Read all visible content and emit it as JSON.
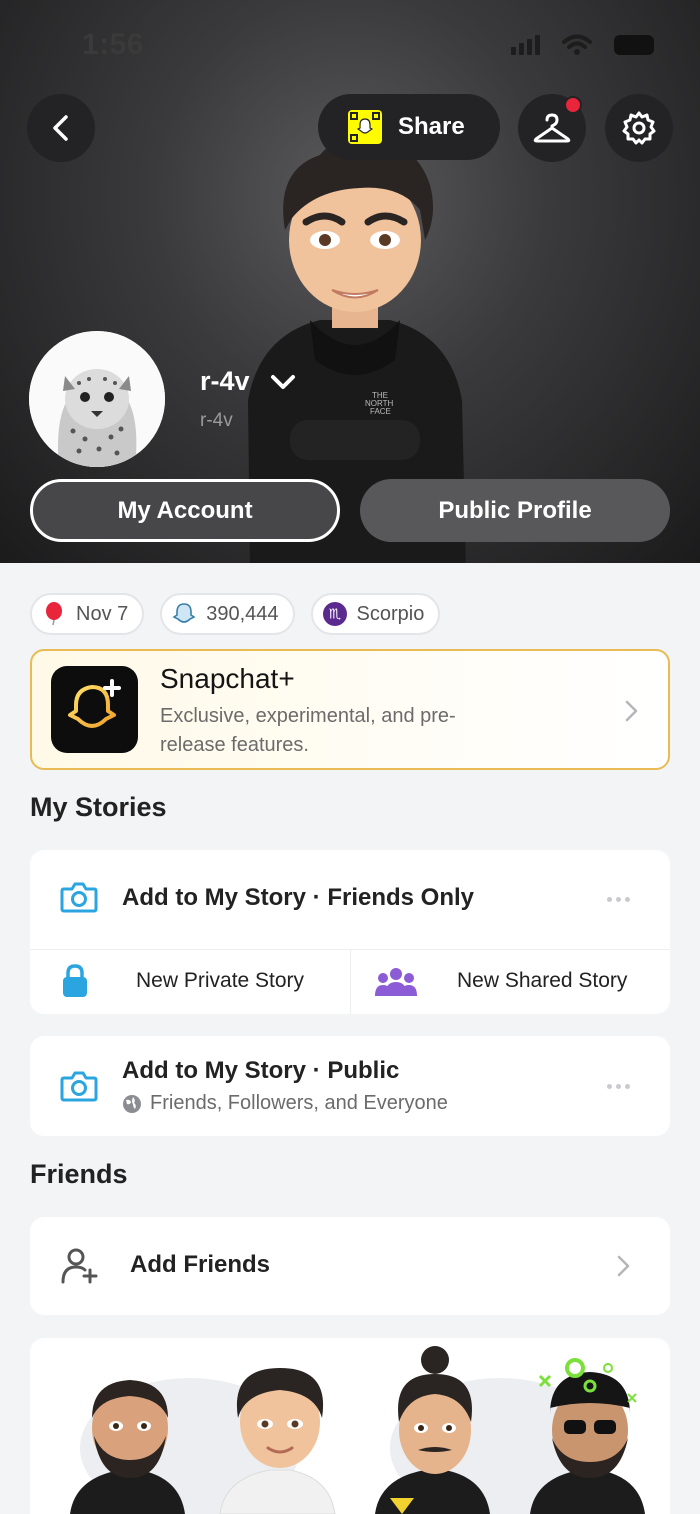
{
  "status_bar": {
    "time": "1:56"
  },
  "header": {
    "share_label": "Share",
    "username": "r-4v",
    "handle": "r-4v",
    "my_account_label": "My Account",
    "public_profile_label": "Public Profile",
    "notification_dot_color": "#e8253a"
  },
  "chips": [
    {
      "icon": "balloon-icon",
      "label": "Nov 7"
    },
    {
      "icon": "ghost-icon",
      "label": "390,444"
    },
    {
      "icon": "scorpio-icon",
      "label": "Scorpio"
    }
  ],
  "snapchat_plus": {
    "title": "Snapchat+",
    "description": "Exclusive, experimental, and pre-release features."
  },
  "my_stories": {
    "section_title": "My Stories",
    "friends_only": "Add to My Story · Friends Only",
    "new_private": "New Private Story",
    "new_shared": "New Shared Story",
    "public_title": "Add to My Story · Public",
    "public_subtitle": "Friends, Followers, and Everyone"
  },
  "friends": {
    "section_title": "Friends",
    "add_friends": "Add Friends"
  },
  "colors": {
    "accent_blue": "#2aa5e0",
    "shared_purple": "#8b5cd6",
    "snap_yellow": "#fffc00",
    "plus_border": "#e8bb55"
  }
}
